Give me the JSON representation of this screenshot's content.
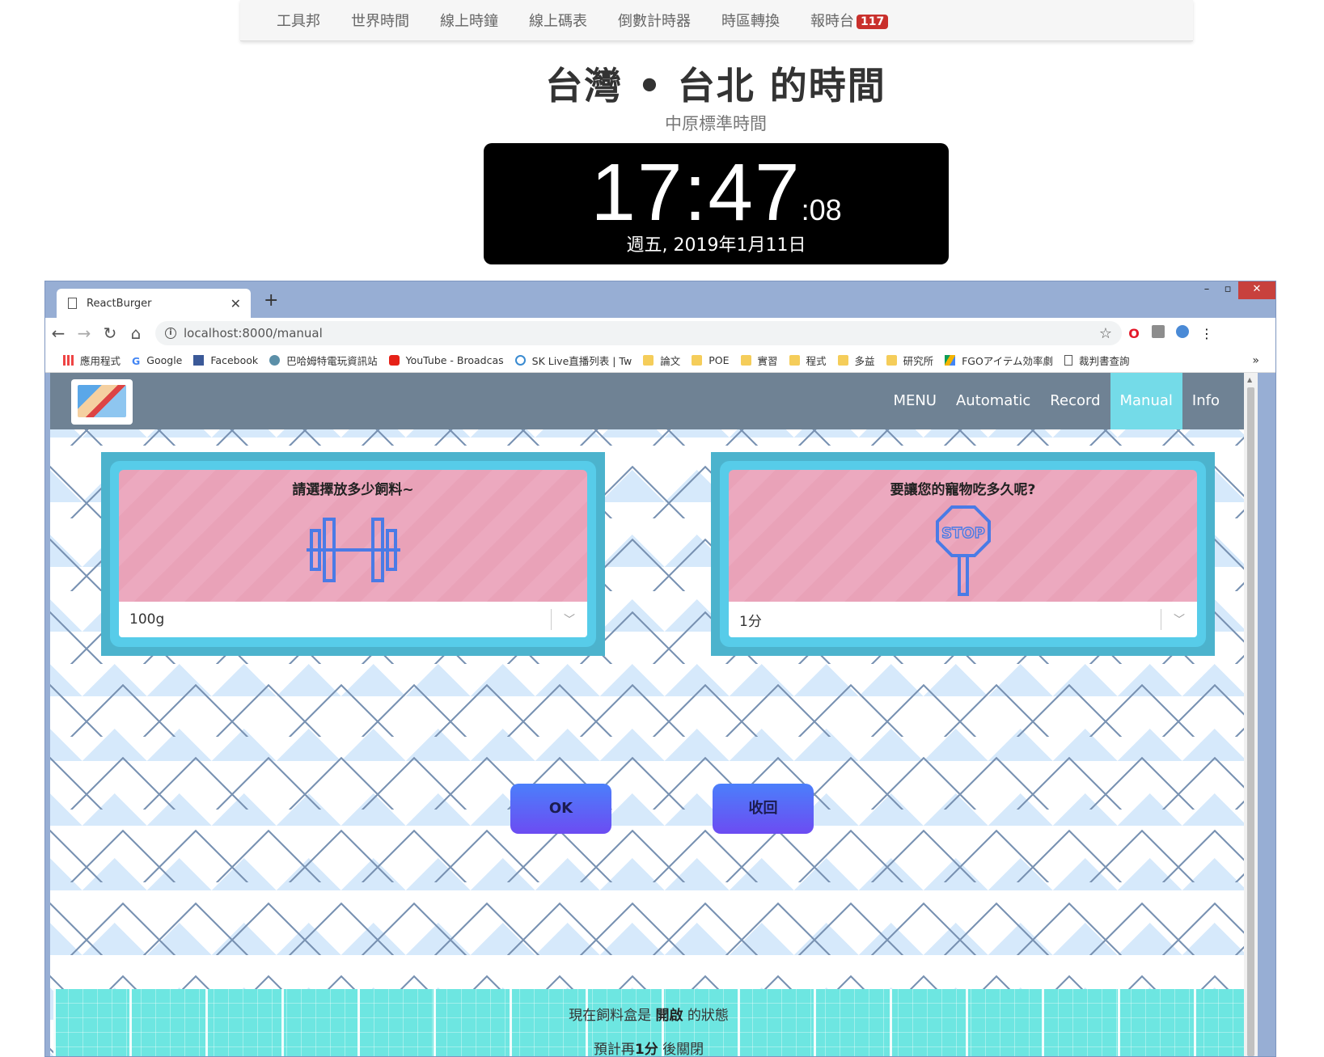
{
  "bg_page": {
    "nav": [
      "工具邦",
      "世界時間",
      "線上時鐘",
      "線上碼表",
      "倒數計時器",
      "時區轉換",
      "報時台"
    ],
    "nav_badge": "117",
    "city_title": "台灣 • 台北 的時間",
    "zone": "中原標準時間",
    "clock": {
      "hm": "17:47",
      "sec": ":08",
      "date": "週五, 2019年1月11日"
    }
  },
  "browser": {
    "tab_title": "ReactBurger",
    "url": "localhost:8000/manual",
    "bookmarks": [
      "應用程式",
      "Google",
      "Facebook",
      "巴哈姆特電玩資訊站",
      "YouTube - Broadcas",
      "SK Live直播列表 | Tw",
      "論文",
      "POE",
      "實習",
      "程式",
      "多益",
      "研究所",
      "FGOアイテム効率劇",
      "裁判書查詢"
    ]
  },
  "app": {
    "menu": [
      "MENU",
      "Automatic",
      "Record",
      "Manual",
      "Info"
    ],
    "active_menu": "Manual",
    "card_food": {
      "title": "請選擇放多少飼料~",
      "selected": "100g"
    },
    "card_time": {
      "title": "要讓您的寵物吃多久呢?",
      "selected": "1分",
      "icon_text": "STOP"
    },
    "ok_label": "OK",
    "retract_label": "收回",
    "status": {
      "line1_prefix": "現在飼料盒是 ",
      "line1_state": "開啟",
      "line1_suffix": " 的狀態",
      "line2_prefix": "預計再",
      "line2_time": "1分",
      "line2_suffix": " 後關閉"
    }
  },
  "colors": {
    "header": "#6f8294",
    "active_tab": "#74dbe8",
    "card_border": "#4cb3cd",
    "panel_pink": "#eca9bf",
    "button_gradient_top": "#4b7ffb",
    "status_bar": "#6de6e1"
  }
}
